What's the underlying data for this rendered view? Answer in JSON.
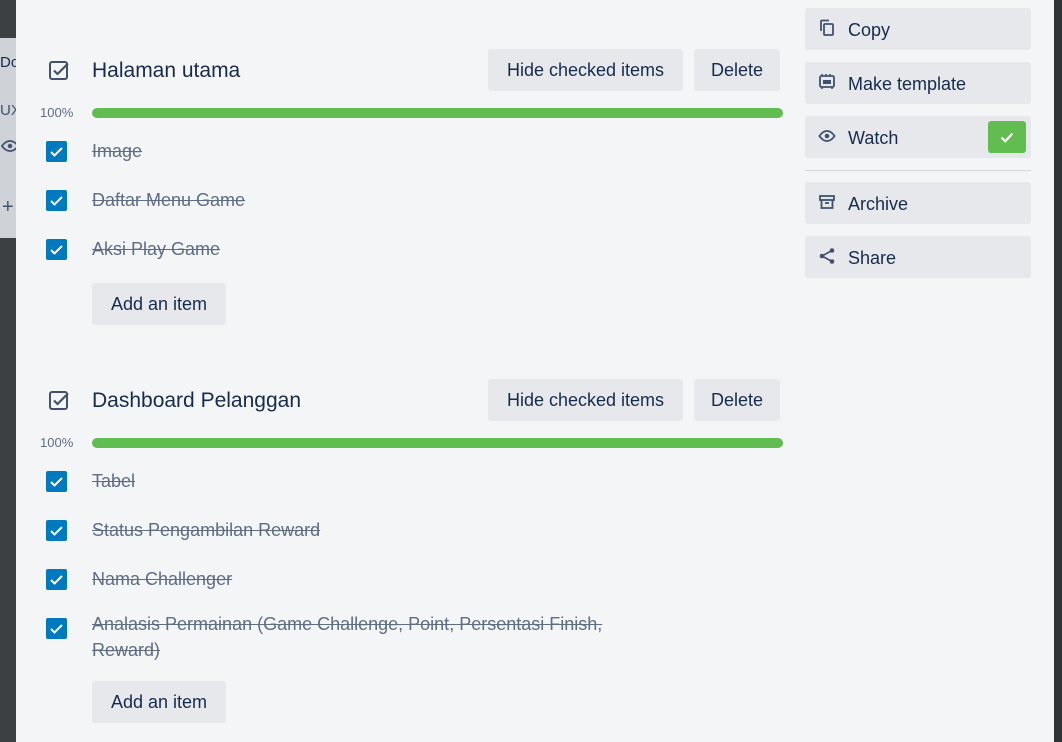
{
  "background": {
    "letters": "Do",
    "ux": "UX",
    "plus": "+"
  },
  "checklists": [
    {
      "title": "Halaman utama",
      "hide_label": "Hide checked items",
      "delete_label": "Delete",
      "progress_text": "100%",
      "progress": 1.0,
      "items": [
        {
          "text": "Image",
          "checked": true
        },
        {
          "text": "Daftar Menu Game",
          "checked": true
        },
        {
          "text": "Aksi Play Game",
          "checked": true
        }
      ],
      "add_label": "Add an item"
    },
    {
      "title": "Dashboard Pelanggan",
      "hide_label": "Hide checked items",
      "delete_label": "Delete",
      "progress_text": "100%",
      "progress": 1.0,
      "items": [
        {
          "text": "Tabel",
          "checked": true
        },
        {
          "text": "Status Pengambilan Reward",
          "checked": true
        },
        {
          "text": "Nama Challenger",
          "checked": true
        },
        {
          "text": "Analasis Permainan (Game Challenge, Point, Persentasi Finish, Reward)",
          "checked": true
        }
      ],
      "add_label": "Add an item"
    }
  ],
  "sidebar": {
    "copy": {
      "label": "Copy",
      "icon": "copy-icon"
    },
    "make_template": {
      "label": "Make template",
      "icon": "template-icon"
    },
    "watch": {
      "label": "Watch",
      "icon": "eye-icon",
      "active": true
    },
    "archive": {
      "label": "Archive",
      "icon": "archive-icon"
    },
    "share": {
      "label": "Share",
      "icon": "share-icon"
    }
  },
  "colors": {
    "checkbox": "#0079bf",
    "progress": "#61bd4f",
    "watch_active": "#61bd4f"
  }
}
